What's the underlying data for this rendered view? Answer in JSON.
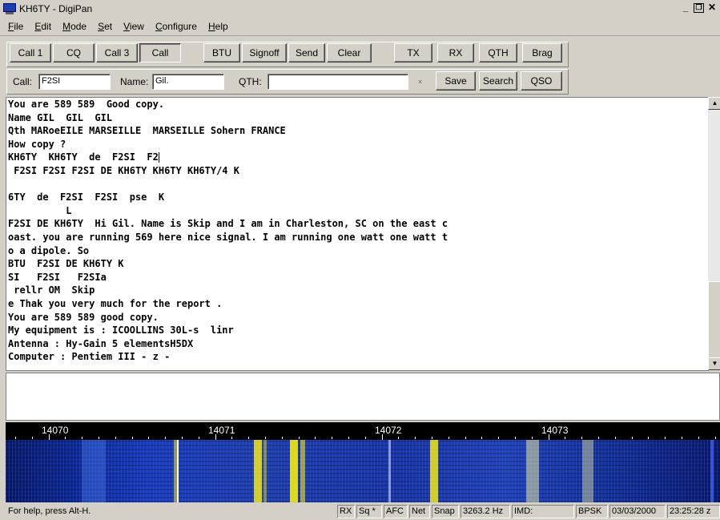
{
  "window": {
    "title": "KH6TY - DigiPan"
  },
  "menu": [
    "File",
    "Edit",
    "Mode",
    "Set",
    "View",
    "Configure",
    "Help"
  ],
  "toolbar": {
    "buttons": [
      "Call 1",
      "CQ",
      "Call 3",
      "Call",
      "BTU",
      "Signoff",
      "Send",
      "Clear",
      "TX",
      "RX",
      "QTH",
      "Brag"
    ]
  },
  "fields": {
    "call_label": "Call:",
    "call_value": "F2SI",
    "name_label": "Name:",
    "name_value": "Gil.",
    "qth_label": "QTH:",
    "qth_value": "",
    "small_x": "×",
    "save": "Save",
    "search": "Search",
    "qso": "QSO"
  },
  "receive_lines": [
    "You are 589 589  Good copy.",
    "Name GIL  GIL  GIL",
    "Qth MARoeEILE MARSEILLE  MARSEILLE Sohern FRANCE",
    "How copy ?",
    "KH6TY  KH6TY  de  F2SI  F2",
    " F2SI F2SI F2SI DE KH6TY KH6TY KH6TY/4 K",
    "",
    "6TY  de  F2SI  F2SI  pse  K",
    "          L",
    "F2SI DE KH6TY  Hi Gil. Name is Skip and I am in Charleston, SC on the east c",
    "oast. you are running 569 here nice signal. I am running one watt one watt t",
    "o a dipole. So",
    "BTU  F2SI DE KH6TY K",
    "SI   F2SI   F2SIa",
    " rellr OM  Skip",
    "e Thak you very much for the report .",
    "You are 589 589 good copy.",
    "My equipment is : ICOOLLINS 30L-s  linr",
    "Antenna : Hy-Gain 5 elementsH5DX",
    "Computer : Pentiem III - z -"
  ],
  "waterfall": {
    "freq_labels": [
      "14070",
      "14071",
      "14072",
      "14073"
    ]
  },
  "status": {
    "help": "For help, press Alt-H.",
    "rx": "RX",
    "sq": "Sq *",
    "afc": "AFC",
    "net": "Net",
    "snap": "Snap",
    "freq": "3263.2 Hz",
    "imd": "IMD:",
    "mode": "BPSK",
    "date": "03/03/2000",
    "time": "23:25:28 z"
  },
  "colors": {
    "titlebar": "#d4d0c8",
    "waterfall_signal": "#f2e81a",
    "waterfall_bg": "#1a3dc0"
  }
}
